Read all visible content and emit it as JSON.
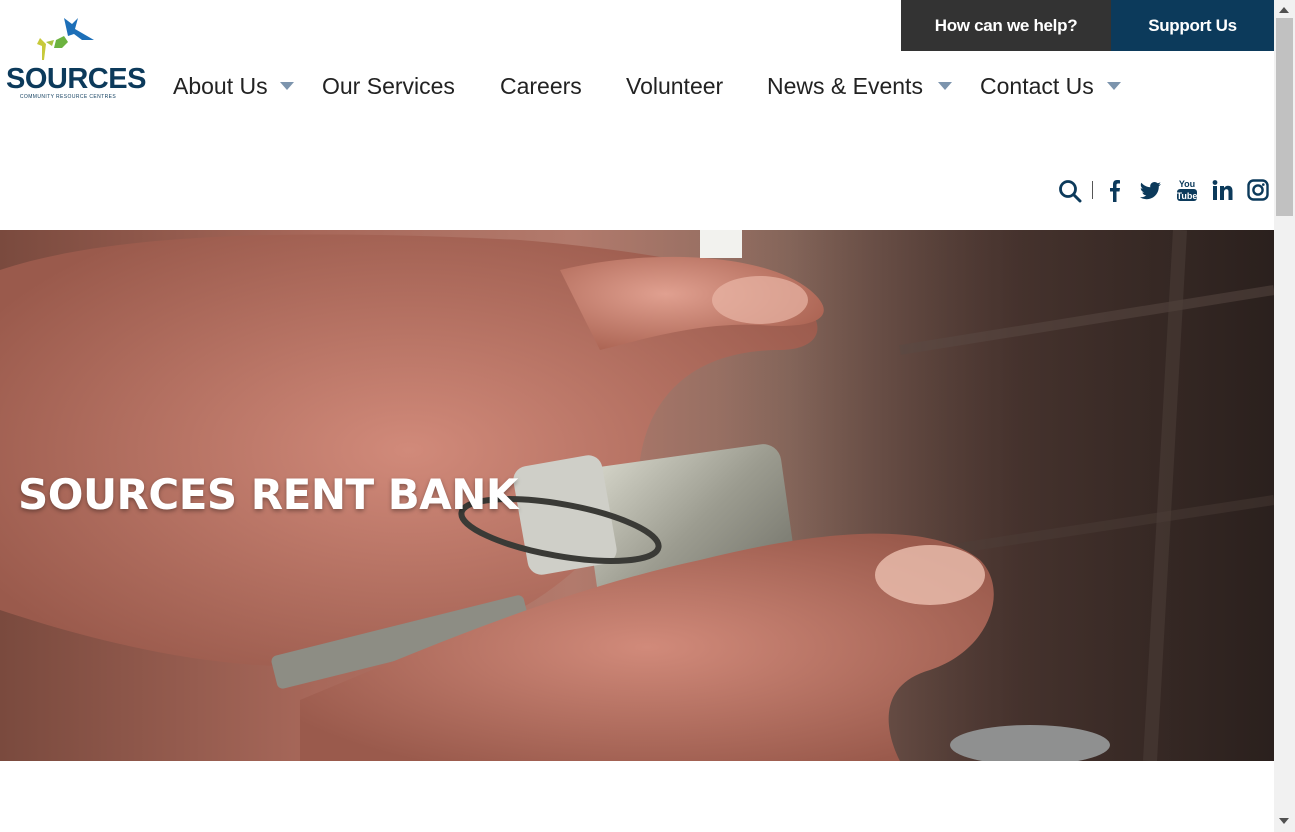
{
  "header": {
    "help_label": "How can we help?",
    "support_label": "Support Us",
    "logo": {
      "wordmark": "SOURCES",
      "tagline": "COMMUNITY RESOURCE CENTRES",
      "icon": "birds-logo-icon"
    }
  },
  "nav": {
    "items": [
      {
        "label": "About Us",
        "has_dropdown": true
      },
      {
        "label": "Our Services",
        "has_dropdown": false
      },
      {
        "label": "Careers",
        "has_dropdown": false
      },
      {
        "label": "Volunteer",
        "has_dropdown": false
      },
      {
        "label": "News & Events",
        "has_dropdown": true
      },
      {
        "label": "Contact Us",
        "has_dropdown": true
      }
    ]
  },
  "social": {
    "icons": [
      "search-icon",
      "facebook-icon",
      "twitter-icon",
      "youtube-icon",
      "linkedin-icon",
      "instagram-icon"
    ]
  },
  "hero": {
    "title": "SOURCES RENT BANK",
    "image": "hands-holding-keys-photo"
  },
  "colors": {
    "brand_navy": "#0c3a5b",
    "help_bg": "#333333",
    "caret": "#7c94ad"
  }
}
